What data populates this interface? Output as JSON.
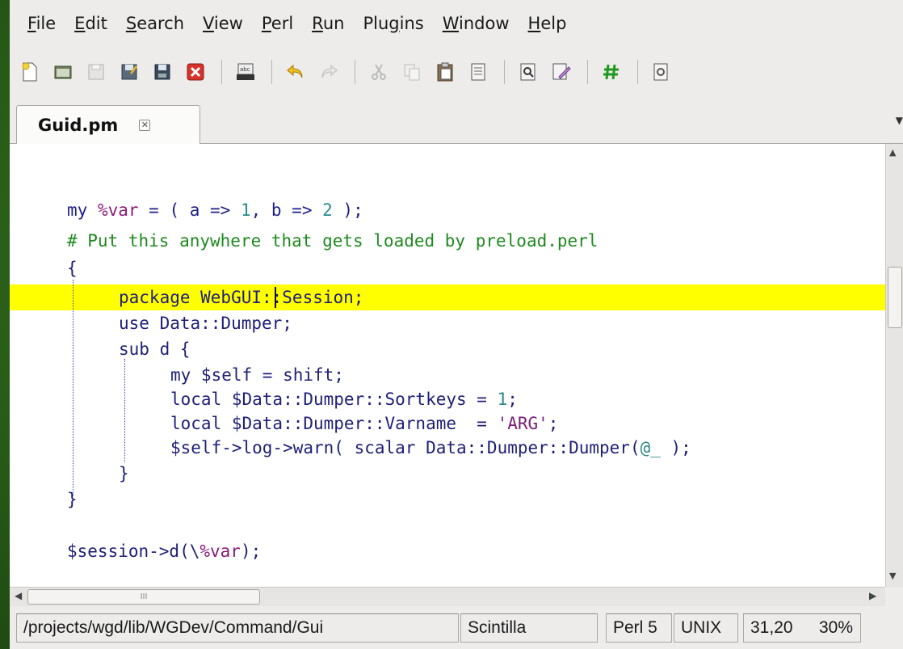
{
  "menu": [
    {
      "key": "F",
      "rest": "ile"
    },
    {
      "key": "E",
      "rest": "dit"
    },
    {
      "key": "S",
      "rest": "earch"
    },
    {
      "key": "V",
      "rest": "iew"
    },
    {
      "key": "P",
      "rest": "erl"
    },
    {
      "key": "R",
      "rest": "un"
    },
    {
      "pre": "Plu",
      "key": "g",
      "rest": "ins"
    },
    {
      "key": "W",
      "rest": "indow"
    },
    {
      "key": "H",
      "rest": "elp"
    }
  ],
  "tab": {
    "label": "Guid.pm",
    "close_glyph": "✕"
  },
  "code": {
    "l1_my": "my ",
    "l1_var": "%var",
    "l1_a": " = ( a => ",
    "l1_n1": "1",
    "l1_b": ", b => ",
    "l1_n2": "2",
    "l1_end": " );",
    "l2_comment": "# Put this anywhere that gets loaded by preload.perl",
    "l3_brace": "{",
    "l4": "package WebGUI::Session;",
    "l5": "use Data::Dumper;",
    "l6": "sub d {",
    "l7": "my $self = shift;",
    "l8_a": "local $Data::Dumper::Sortkeys = ",
    "l8_n": "1",
    "l8_end": ";",
    "l9_a": "local $Data::Dumper::Varname  = ",
    "l9_s": "'ARG'",
    "l9_end": ";",
    "l10_a": "$self->log->warn( scalar Data::Dumper::Dumper(",
    "l10_v": "@_",
    "l10_end": " );",
    "l11": "}",
    "l12": "}",
    "l13_a": "$session->d(\\",
    "l13_v": "%var",
    "l13_end": ");"
  },
  "status": {
    "path": "/projects/wgd/lib/WGDev/Command/Gui",
    "lexer": "Scintilla",
    "language": "Perl 5",
    "newline": "UNIX",
    "position": "31,20",
    "percent": "30%"
  },
  "hscroll_grip": "III"
}
